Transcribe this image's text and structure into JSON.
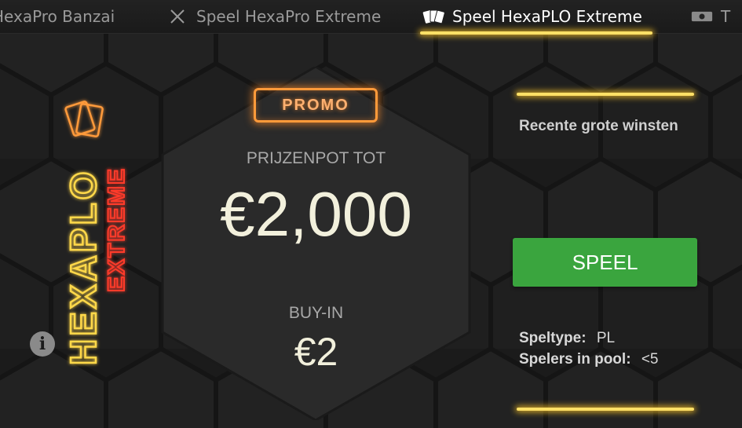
{
  "tabs": [
    {
      "label": "HexaPro Banzai",
      "icon": "none",
      "active": false
    },
    {
      "label": "Speel HexaPro Extreme",
      "icon": "crossed-swords-icon",
      "active": false
    },
    {
      "label": "Speel HexaPLO Extreme",
      "icon": "cards-icon",
      "active": true
    },
    {
      "label": "T",
      "icon": "ticket-icon",
      "active": false
    }
  ],
  "logo": {
    "word1": "HEXAPLO",
    "word2": "EXTREME"
  },
  "promo_badge": "PROMO",
  "prize": {
    "label": "PRIJZENPOT TOT",
    "value": "€2,000"
  },
  "buyin": {
    "label": "BUY-IN",
    "value": "€2"
  },
  "recent_wins_label": "Recente grote winsten",
  "play_button": "SPEEL",
  "game_info": {
    "type_label": "Speltype:",
    "type_value": "PL",
    "players_label": "Spelers in pool:",
    "players_value": "<5"
  },
  "colors": {
    "accent_yellow": "#ffe066",
    "promo_orange": "#ff9a3a",
    "play_green": "#3aa53e",
    "logo_red": "#ff3a2a"
  }
}
